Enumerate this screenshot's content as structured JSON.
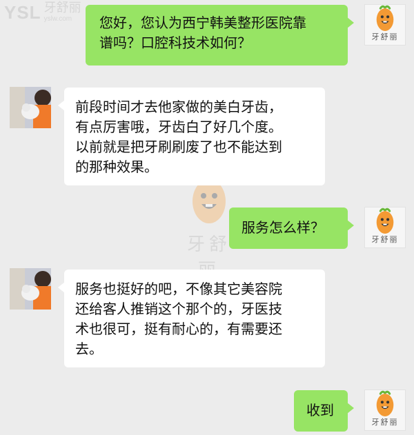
{
  "watermark": {
    "logo_text": "YSL",
    "brand": "牙舒丽",
    "url": "yslw.com"
  },
  "messages": [
    {
      "side": "right",
      "avatar_label": "牙舒丽",
      "lines": [
        "您好，您认为西宁韩美整形医院靠",
        "谱吗？口腔科技术如何？"
      ]
    },
    {
      "side": "left",
      "lines": [
        "前段时间才去他家做的美白牙齿，",
        "有点厉害哦，牙齿白了好几个度。",
        "以前就是把牙刷刷废了也不能达到",
        "的那种效果。"
      ]
    },
    {
      "side": "right",
      "avatar_label": "牙舒丽",
      "lines": [
        "服务怎么样？"
      ]
    },
    {
      "side": "left",
      "lines": [
        "服务也挺好的吧，不像其它美容院",
        "还给客人推销这个那个的，牙医技",
        "术也很可，挺有耐心的，有需要还",
        "去。"
      ]
    },
    {
      "side": "right",
      "avatar_label": "牙舒丽",
      "lines": [
        "收到"
      ]
    }
  ],
  "colors": {
    "background": "#ececec",
    "outgoing_bubble": "#97e464",
    "incoming_bubble": "#ffffff"
  }
}
